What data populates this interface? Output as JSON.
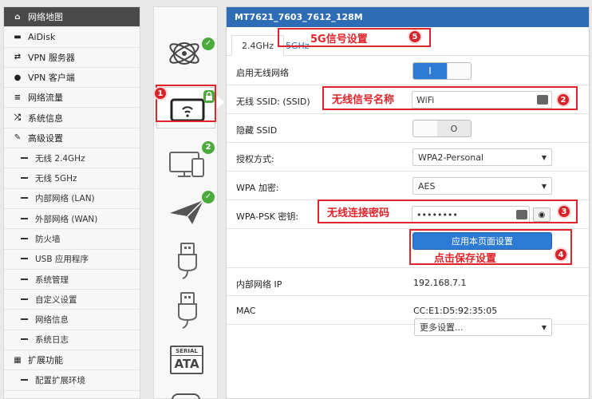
{
  "sidebar": {
    "items": [
      {
        "label": "网络地图",
        "icon": "home-icon",
        "active": true
      },
      {
        "label": "AiDisk",
        "icon": "disk-icon"
      },
      {
        "label": "VPN 服务器",
        "icon": "vpn-server-icon"
      },
      {
        "label": "VPN 客户端",
        "icon": "globe-icon"
      },
      {
        "label": "网络流量",
        "icon": "traffic-icon"
      },
      {
        "label": "系统信息",
        "icon": "shuffle-icon"
      },
      {
        "label": "高级设置",
        "icon": "wrench-icon"
      },
      {
        "label": "无线 2.4GHz",
        "sub": true
      },
      {
        "label": "无线 5GHz",
        "sub": true
      },
      {
        "label": "内部网络 (LAN)",
        "sub": true
      },
      {
        "label": "外部网络 (WAN)",
        "sub": true
      },
      {
        "label": "防火墙",
        "sub": true
      },
      {
        "label": "USB 应用程序",
        "sub": true
      },
      {
        "label": "系统管理",
        "sub": true
      },
      {
        "label": "自定义设置",
        "sub": true
      },
      {
        "label": "网络信息",
        "sub": true
      },
      {
        "label": "系统日志",
        "sub": true
      },
      {
        "label": "扩展功能",
        "icon": "grid-icon"
      },
      {
        "label": "配置扩展环境",
        "sub": true
      }
    ]
  },
  "icons": {
    "status_badges": [
      "2"
    ],
    "serial_label": "SERIAL",
    "ata_label": "ATA"
  },
  "main": {
    "title": "MT7621_7603_7612_128M",
    "tabs": [
      {
        "label": "2.4GHz",
        "active": true
      },
      {
        "label": "5GHz",
        "active": false
      }
    ],
    "rows": {
      "enable_wireless": {
        "label": "启用无线网络",
        "toggle_on": "I"
      },
      "ssid": {
        "label": "无线 SSID: (SSID)",
        "value": "WiFi"
      },
      "hide_ssid": {
        "label": "隐藏 SSID",
        "toggle_off": "O"
      },
      "auth": {
        "label": "授权方式:",
        "value": "WPA2-Personal"
      },
      "wpa_enc": {
        "label": "WPA 加密:",
        "value": "AES"
      },
      "psk": {
        "label": "WPA-PSK 密钥:",
        "value": "••••••••"
      },
      "apply": {
        "label": "应用本页面设置"
      },
      "lan_ip": {
        "label": "内部网络 IP",
        "value": "192.168.7.1"
      },
      "mac": {
        "label": "MAC",
        "value": "CC:E1:D5:92:35:05"
      },
      "more": {
        "value": "更多设置..."
      }
    }
  },
  "annotations": {
    "n1": "1",
    "n2": "2",
    "n3": "3",
    "n4": "4",
    "n5": "5",
    "t2": "无线信号名称",
    "t3": "无线连接密码",
    "t4": "点击保存设置",
    "t5": "5G信号设置"
  },
  "colors": {
    "accent": "#2e6db5",
    "button": "#2e7bd6",
    "badge_green": "#4caa3c",
    "annotation_red": "#e0242b"
  }
}
